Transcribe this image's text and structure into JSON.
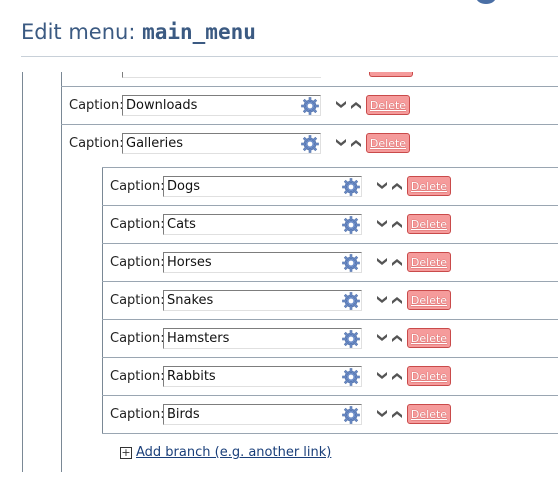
{
  "page": {
    "title_prefix": "Edit menu: ",
    "title_menu_name": "main_menu"
  },
  "rows": [
    {
      "label": "Caption:",
      "value": "Downloads"
    },
    {
      "label": "Caption:",
      "value": "Galleries"
    }
  ],
  "sub_rows": [
    {
      "label": "Caption:",
      "value": "Dogs"
    },
    {
      "label": "Caption:",
      "value": "Cats"
    },
    {
      "label": "Caption:",
      "value": "Horses"
    },
    {
      "label": "Caption:",
      "value": "Snakes"
    },
    {
      "label": "Caption:",
      "value": "Hamsters"
    },
    {
      "label": "Caption:",
      "value": "Rabbits"
    },
    {
      "label": "Caption:",
      "value": "Birds"
    }
  ],
  "buttons": {
    "delete_label": "Delete"
  },
  "add_branch": {
    "label": "Add branch (e.g. another link)"
  },
  "icons": {
    "picker": "gear-icon",
    "move_down": "chevron-down-icon",
    "move_up": "chevron-up-icon",
    "add": "plus-box-icon"
  },
  "colors": {
    "title": "#3b5a82",
    "delete_bg": "#f59b9b",
    "delete_border": "#c94a4a",
    "link": "#1a3f7a"
  }
}
